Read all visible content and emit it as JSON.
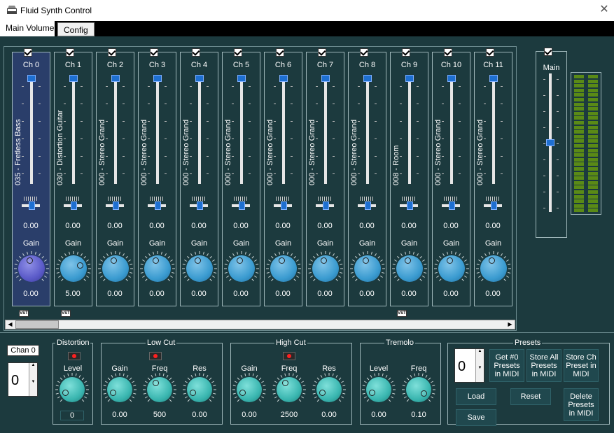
{
  "window": {
    "title": "Fluid Synth Control"
  },
  "tabs": [
    {
      "label": "Main Volume"
    },
    {
      "label": "Config"
    }
  ],
  "channels": [
    {
      "name": "Ch 0",
      "instrument": "035 - Fretless Bass",
      "pan_value": "0.00",
      "gain_label": "Gain",
      "gain_value": "0.00",
      "fader": 1.0,
      "vst": true
    },
    {
      "name": "Ch 1",
      "instrument": "030 - Distortion Guitar",
      "pan_value": "0.00",
      "gain_label": "Gain",
      "gain_value": "5.00",
      "fader": 1.0,
      "vst": true
    },
    {
      "name": "Ch 2",
      "instrument": "000 - Stereo Grand",
      "pan_value": "0.00",
      "gain_label": "Gain",
      "gain_value": "0.00",
      "fader": 1.0,
      "vst": false
    },
    {
      "name": "Ch 3",
      "instrument": "000 - Stereo Grand",
      "pan_value": "0.00",
      "gain_label": "Gain",
      "gain_value": "0.00",
      "fader": 1.0,
      "vst": false
    },
    {
      "name": "Ch 4",
      "instrument": "000 - Stereo Grand",
      "pan_value": "0.00",
      "gain_label": "Gain",
      "gain_value": "0.00",
      "fader": 1.0,
      "vst": false
    },
    {
      "name": "Ch 5",
      "instrument": "000 - Stereo Grand",
      "pan_value": "0.00",
      "gain_label": "Gain",
      "gain_value": "0.00",
      "fader": 1.0,
      "vst": false
    },
    {
      "name": "Ch 6",
      "instrument": "000 - Stereo Grand",
      "pan_value": "0.00",
      "gain_label": "Gain",
      "gain_value": "0.00",
      "fader": 1.0,
      "vst": false
    },
    {
      "name": "Ch 7",
      "instrument": "000 - Stereo Grand",
      "pan_value": "0.00",
      "gain_label": "Gain",
      "gain_value": "0.00",
      "fader": 1.0,
      "vst": false
    },
    {
      "name": "Ch 8",
      "instrument": "000 - Stereo Grand",
      "pan_value": "0.00",
      "gain_label": "Gain",
      "gain_value": "0.00",
      "fader": 1.0,
      "vst": false
    },
    {
      "name": "Ch 9",
      "instrument": "008 - Room",
      "pan_value": "0.00",
      "gain_label": "Gain",
      "gain_value": "0.00",
      "fader": 1.0,
      "vst": true
    },
    {
      "name": "Ch 10",
      "instrument": "000 - Stereo Grand",
      "pan_value": "0.00",
      "gain_label": "Gain",
      "gain_value": "0.00",
      "fader": 1.0,
      "vst": false
    },
    {
      "name": "Ch 11",
      "instrument": "000 - Stereo Grand",
      "pan_value": "0.00",
      "gain_label": "Gain",
      "gain_value": "0.00",
      "fader": 1.0,
      "vst": false
    }
  ],
  "vst_label": "VST",
  "main": {
    "label": "Main",
    "fader": 0.5
  },
  "bottom": {
    "chan_label": "Chan 0",
    "chan_value": "0",
    "distortion": {
      "title": "Distortion",
      "level_label": "Level",
      "level_value": "0"
    },
    "lowcut": {
      "title": "Low Cut",
      "gain_label": "Gain",
      "freq_label": "Freq",
      "res_label": "Res",
      "gain_value": "0.00",
      "freq_value": "500",
      "res_value": "0.00"
    },
    "highcut": {
      "title": "High Cut",
      "gain_label": "Gain",
      "freq_label": "Freq",
      "res_label": "Res",
      "gain_value": "0.00",
      "freq_value": "2500",
      "res_value": "0.00"
    },
    "tremolo": {
      "title": "Tremolo",
      "level_label": "Level",
      "freq_label": "Freq",
      "level_value": "0.00",
      "freq_value": "0.10"
    },
    "presets": {
      "title": "Presets",
      "spin_value": "0",
      "get_label": "Get #0 Presets in MIDI",
      "store_all_label": "Store All Presets in MIDI",
      "store_ch_label": "Store Ch Preset in MIDI",
      "load_label": "Load",
      "reset_label": "Reset",
      "delete_label": "Delete Presets in MIDI",
      "save_label": "Save"
    }
  },
  "colors": {
    "bg": "#1c3a3e",
    "accent": "#1e6fd0",
    "knob": "#3a9bd0",
    "knob_sel": "#5a5ac8",
    "knob_teal": "#3ab6b0",
    "meter": "#5a8a16"
  }
}
